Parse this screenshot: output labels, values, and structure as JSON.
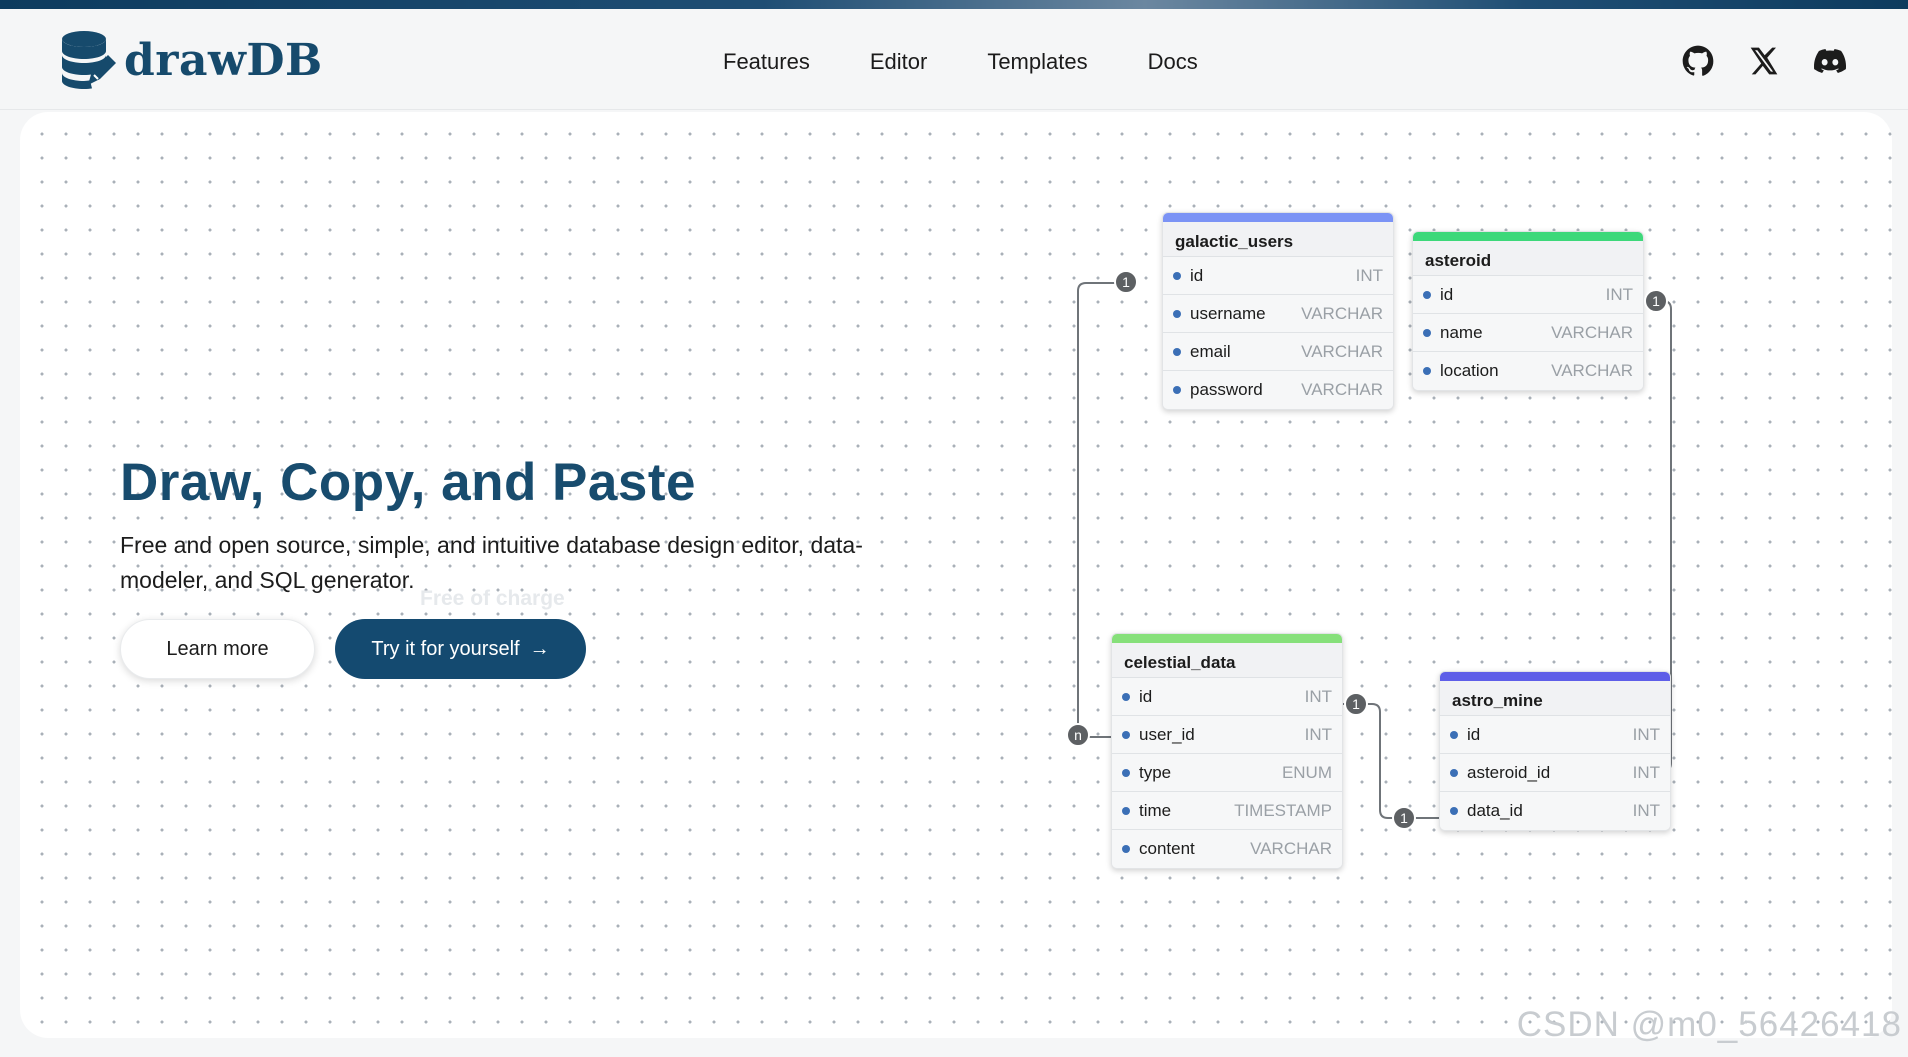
{
  "nav": {
    "logo_text": "drawDB",
    "links": [
      "Features",
      "Editor",
      "Templates",
      "Docs"
    ],
    "social_icons": [
      "github-icon",
      "x-icon",
      "discord-icon"
    ]
  },
  "hero": {
    "title": "Draw, Copy, and Paste",
    "description": "Free and open source, simple, and intuitive database design editor, data-modeler, and SQL generator.",
    "ghost_text": "Free of charge",
    "learn_more": "Learn more",
    "try_it": "Try it for yourself",
    "try_arrow": "→"
  },
  "tables": [
    {
      "name": "galactic_users",
      "color": "#7b93f5",
      "fields": [
        [
          "id",
          "INT"
        ],
        [
          "username",
          "VARCHAR"
        ],
        [
          "email",
          "VARCHAR"
        ],
        [
          "password",
          "VARCHAR"
        ]
      ]
    },
    {
      "name": "asteroid",
      "color": "#3dd87a",
      "fields": [
        [
          "id",
          "INT"
        ],
        [
          "name",
          "VARCHAR"
        ],
        [
          "location",
          "VARCHAR"
        ]
      ]
    },
    {
      "name": "celestial_data",
      "color": "#86e07a",
      "fields": [
        [
          "id",
          "INT"
        ],
        [
          "user_id",
          "INT"
        ],
        [
          "type",
          "ENUM"
        ],
        [
          "time",
          "TIMESTAMP"
        ],
        [
          "content",
          "VARCHAR"
        ]
      ]
    },
    {
      "name": "astro_mine",
      "color": "#5e5ee8",
      "fields": [
        [
          "id",
          "INT"
        ],
        [
          "asteroid_id",
          "INT"
        ],
        [
          "data_id",
          "INT"
        ]
      ]
    }
  ],
  "badges": [
    "1",
    "1",
    "1",
    "1",
    "n"
  ],
  "watermark": "CSDN @m0_56426418"
}
